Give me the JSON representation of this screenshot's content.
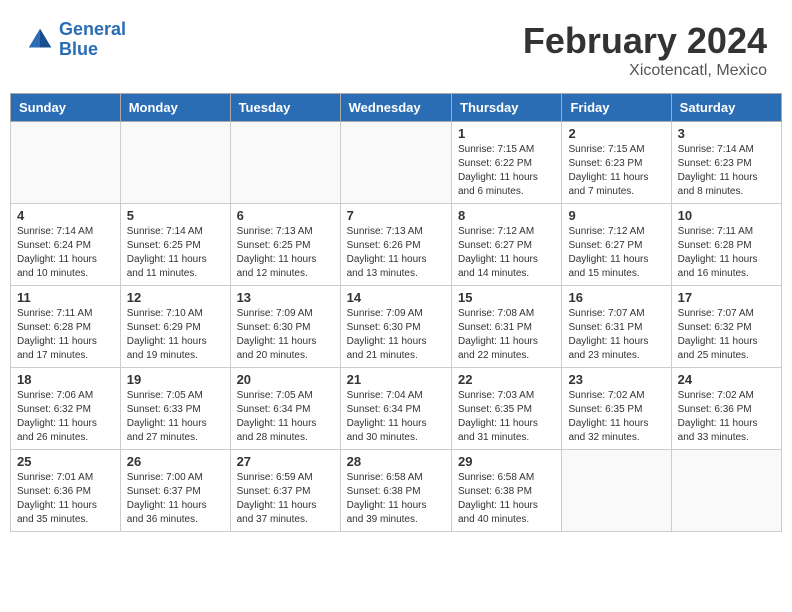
{
  "header": {
    "logo_line1": "General",
    "logo_line2": "Blue",
    "month_year": "February 2024",
    "location": "Xicotencatl, Mexico"
  },
  "weekdays": [
    "Sunday",
    "Monday",
    "Tuesday",
    "Wednesday",
    "Thursday",
    "Friday",
    "Saturday"
  ],
  "weeks": [
    [
      {
        "day": "",
        "info": ""
      },
      {
        "day": "",
        "info": ""
      },
      {
        "day": "",
        "info": ""
      },
      {
        "day": "",
        "info": ""
      },
      {
        "day": "1",
        "info": "Sunrise: 7:15 AM\nSunset: 6:22 PM\nDaylight: 11 hours\nand 6 minutes."
      },
      {
        "day": "2",
        "info": "Sunrise: 7:15 AM\nSunset: 6:23 PM\nDaylight: 11 hours\nand 7 minutes."
      },
      {
        "day": "3",
        "info": "Sunrise: 7:14 AM\nSunset: 6:23 PM\nDaylight: 11 hours\nand 8 minutes."
      }
    ],
    [
      {
        "day": "4",
        "info": "Sunrise: 7:14 AM\nSunset: 6:24 PM\nDaylight: 11 hours\nand 10 minutes."
      },
      {
        "day": "5",
        "info": "Sunrise: 7:14 AM\nSunset: 6:25 PM\nDaylight: 11 hours\nand 11 minutes."
      },
      {
        "day": "6",
        "info": "Sunrise: 7:13 AM\nSunset: 6:25 PM\nDaylight: 11 hours\nand 12 minutes."
      },
      {
        "day": "7",
        "info": "Sunrise: 7:13 AM\nSunset: 6:26 PM\nDaylight: 11 hours\nand 13 minutes."
      },
      {
        "day": "8",
        "info": "Sunrise: 7:12 AM\nSunset: 6:27 PM\nDaylight: 11 hours\nand 14 minutes."
      },
      {
        "day": "9",
        "info": "Sunrise: 7:12 AM\nSunset: 6:27 PM\nDaylight: 11 hours\nand 15 minutes."
      },
      {
        "day": "10",
        "info": "Sunrise: 7:11 AM\nSunset: 6:28 PM\nDaylight: 11 hours\nand 16 minutes."
      }
    ],
    [
      {
        "day": "11",
        "info": "Sunrise: 7:11 AM\nSunset: 6:28 PM\nDaylight: 11 hours\nand 17 minutes."
      },
      {
        "day": "12",
        "info": "Sunrise: 7:10 AM\nSunset: 6:29 PM\nDaylight: 11 hours\nand 19 minutes."
      },
      {
        "day": "13",
        "info": "Sunrise: 7:09 AM\nSunset: 6:30 PM\nDaylight: 11 hours\nand 20 minutes."
      },
      {
        "day": "14",
        "info": "Sunrise: 7:09 AM\nSunset: 6:30 PM\nDaylight: 11 hours\nand 21 minutes."
      },
      {
        "day": "15",
        "info": "Sunrise: 7:08 AM\nSunset: 6:31 PM\nDaylight: 11 hours\nand 22 minutes."
      },
      {
        "day": "16",
        "info": "Sunrise: 7:07 AM\nSunset: 6:31 PM\nDaylight: 11 hours\nand 23 minutes."
      },
      {
        "day": "17",
        "info": "Sunrise: 7:07 AM\nSunset: 6:32 PM\nDaylight: 11 hours\nand 25 minutes."
      }
    ],
    [
      {
        "day": "18",
        "info": "Sunrise: 7:06 AM\nSunset: 6:32 PM\nDaylight: 11 hours\nand 26 minutes."
      },
      {
        "day": "19",
        "info": "Sunrise: 7:05 AM\nSunset: 6:33 PM\nDaylight: 11 hours\nand 27 minutes."
      },
      {
        "day": "20",
        "info": "Sunrise: 7:05 AM\nSunset: 6:34 PM\nDaylight: 11 hours\nand 28 minutes."
      },
      {
        "day": "21",
        "info": "Sunrise: 7:04 AM\nSunset: 6:34 PM\nDaylight: 11 hours\nand 30 minutes."
      },
      {
        "day": "22",
        "info": "Sunrise: 7:03 AM\nSunset: 6:35 PM\nDaylight: 11 hours\nand 31 minutes."
      },
      {
        "day": "23",
        "info": "Sunrise: 7:02 AM\nSunset: 6:35 PM\nDaylight: 11 hours\nand 32 minutes."
      },
      {
        "day": "24",
        "info": "Sunrise: 7:02 AM\nSunset: 6:36 PM\nDaylight: 11 hours\nand 33 minutes."
      }
    ],
    [
      {
        "day": "25",
        "info": "Sunrise: 7:01 AM\nSunset: 6:36 PM\nDaylight: 11 hours\nand 35 minutes."
      },
      {
        "day": "26",
        "info": "Sunrise: 7:00 AM\nSunset: 6:37 PM\nDaylight: 11 hours\nand 36 minutes."
      },
      {
        "day": "27",
        "info": "Sunrise: 6:59 AM\nSunset: 6:37 PM\nDaylight: 11 hours\nand 37 minutes."
      },
      {
        "day": "28",
        "info": "Sunrise: 6:58 AM\nSunset: 6:38 PM\nDaylight: 11 hours\nand 39 minutes."
      },
      {
        "day": "29",
        "info": "Sunrise: 6:58 AM\nSunset: 6:38 PM\nDaylight: 11 hours\nand 40 minutes."
      },
      {
        "day": "",
        "info": ""
      },
      {
        "day": "",
        "info": ""
      }
    ]
  ]
}
